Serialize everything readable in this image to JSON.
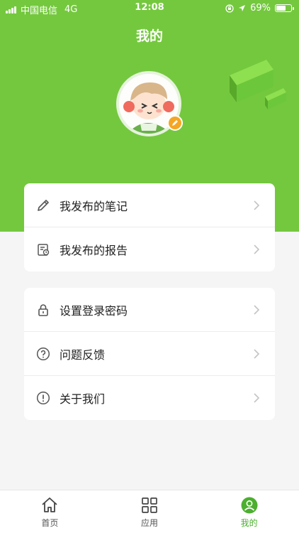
{
  "status_bar": {
    "carrier": "中国电信",
    "network": "4G",
    "time": "12:08",
    "battery": "69%",
    "battery_level": 0.69
  },
  "page": {
    "title": "我的"
  },
  "colors": {
    "header_bg": "#74c83e",
    "accent": "#4caf2f",
    "badge": "#f5a623"
  },
  "profile": {
    "avatar_icon": "avatar-illustration",
    "edit_icon": "pencil-icon"
  },
  "menu_group_1": [
    {
      "label": "我发布的笔记",
      "icon": "pencil-icon"
    },
    {
      "label": "我发布的报告",
      "icon": "report-icon"
    }
  ],
  "menu_group_2": [
    {
      "label": "设置登录密码",
      "icon": "lock-icon"
    },
    {
      "label": "问题反馈",
      "icon": "question-icon"
    },
    {
      "label": "关于我们",
      "icon": "info-icon"
    }
  ],
  "tabs": [
    {
      "label": "首页",
      "icon": "home-icon"
    },
    {
      "label": "应用",
      "icon": "grid-icon"
    },
    {
      "label": "我的",
      "icon": "user-icon",
      "active": true
    }
  ]
}
